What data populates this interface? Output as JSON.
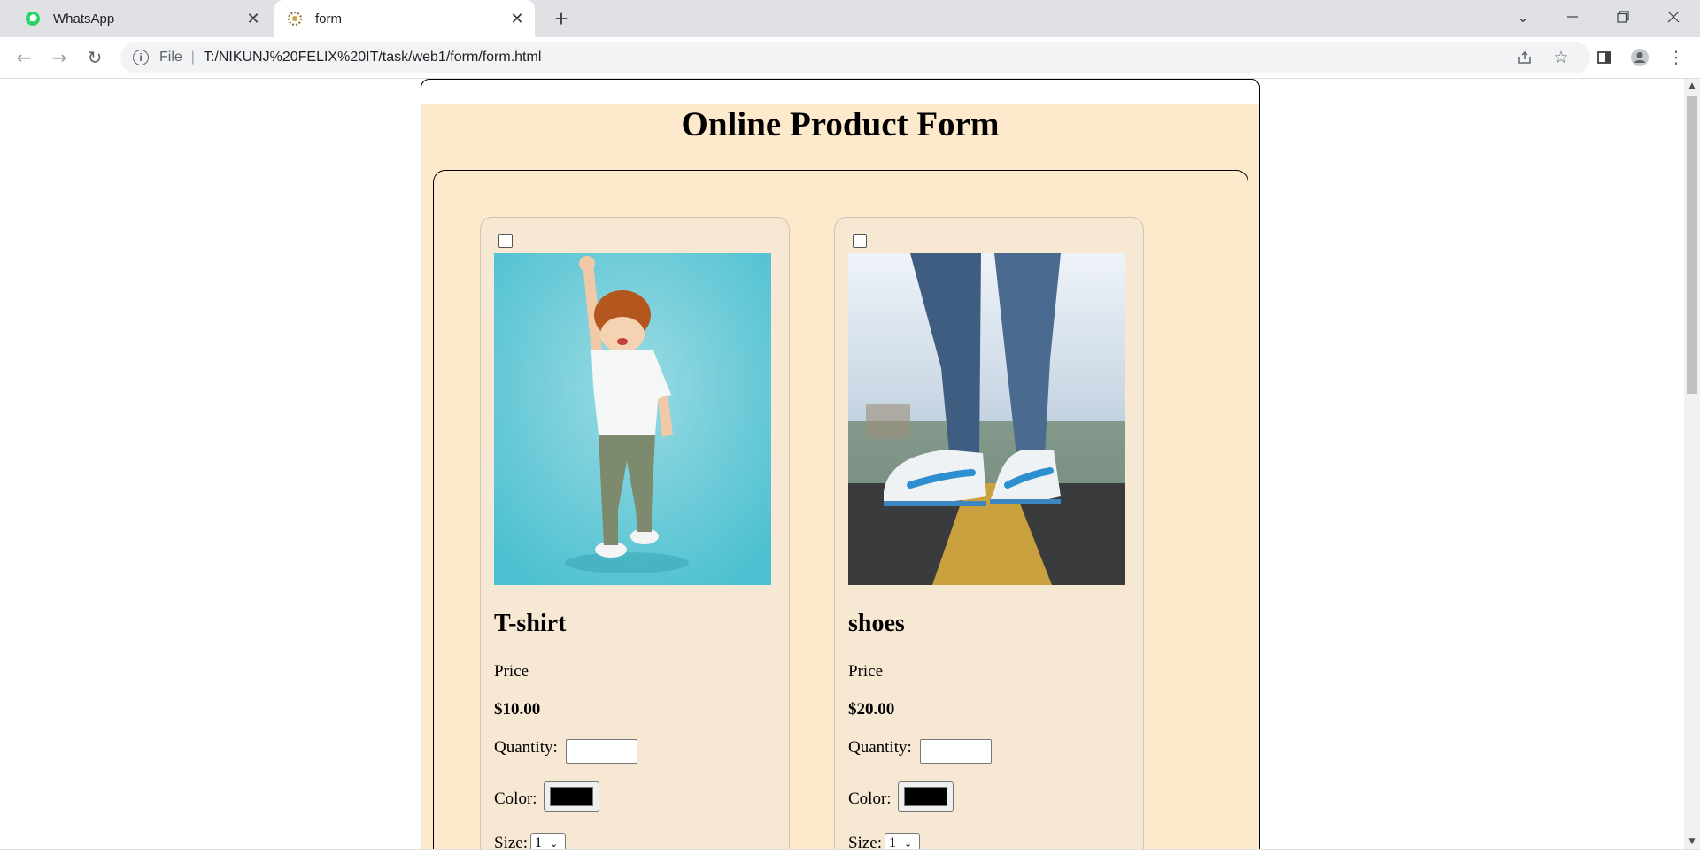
{
  "browser": {
    "tabs": [
      {
        "title": "WhatsApp",
        "active": false,
        "icon": "whatsapp-icon"
      },
      {
        "title": "form",
        "active": true,
        "icon": "page-favicon-icon"
      }
    ],
    "address": {
      "scheme_label": "File",
      "url": "T:/NIKUNJ%20FELIX%20IT/task/web1/form/form.html"
    }
  },
  "page": {
    "title": "Online Product Form",
    "products": [
      {
        "name": "T-shirt",
        "price_label": "Price",
        "price": "$10.00",
        "quantity_label": "Quantity:",
        "quantity_value": "",
        "color_label": "Color:",
        "color_value": "#000000",
        "size_label": "Size:",
        "size_value": "1",
        "checked": false
      },
      {
        "name": "shoes",
        "price_label": "Price",
        "price": "$20.00",
        "quantity_label": "Quantity:",
        "quantity_value": "",
        "color_label": "Color:",
        "color_value": "#000000",
        "size_label": "Size:",
        "size_value": "1",
        "checked": false
      }
    ]
  },
  "colors": {
    "form_bg": "#fde9cc",
    "card_bg": "#f7e8d4",
    "tabbar_bg": "#dfe1e5"
  }
}
